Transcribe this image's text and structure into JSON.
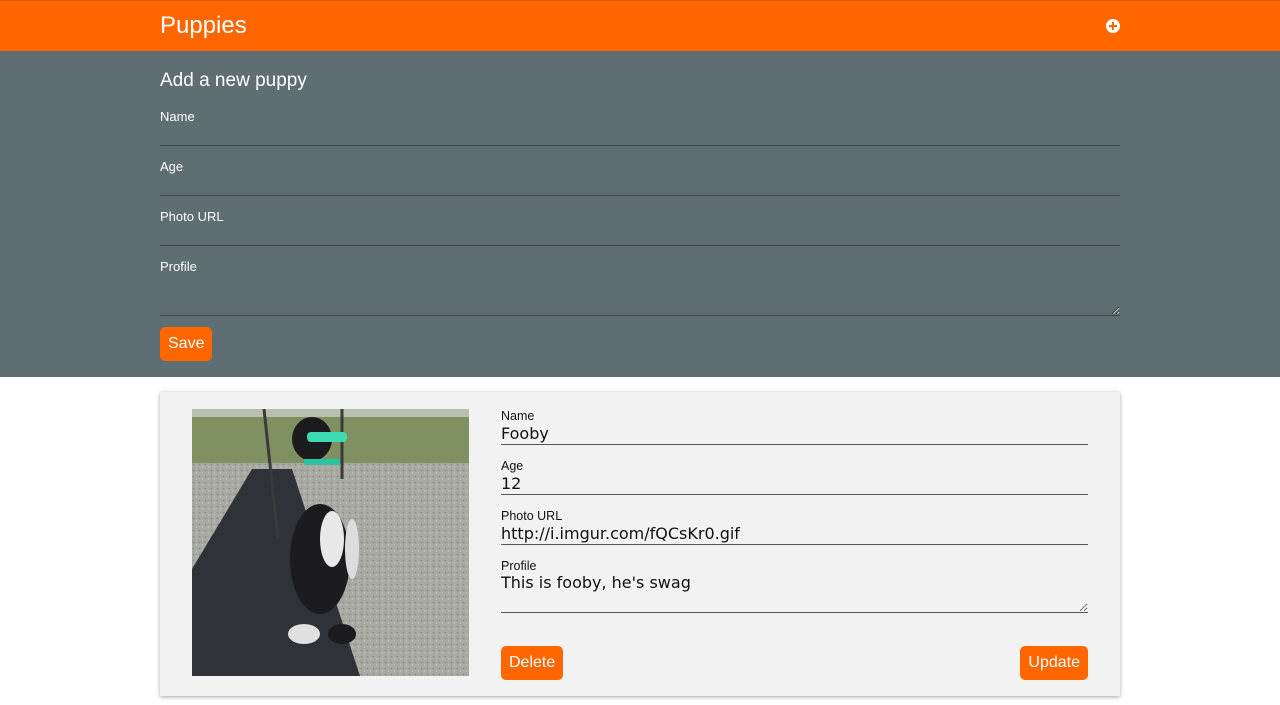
{
  "header": {
    "title": "Puppies",
    "add_icon": "plus-circle-icon"
  },
  "new_puppy_form": {
    "heading": "Add a new puppy",
    "fields": {
      "name": {
        "label": "Name",
        "value": ""
      },
      "age": {
        "label": "Age",
        "value": ""
      },
      "photo_url": {
        "label": "Photo URL",
        "value": ""
      },
      "profile": {
        "label": "Profile",
        "value": ""
      }
    },
    "save_label": "Save"
  },
  "puppy_card": {
    "photo_alt": "Dog with sunglasses on a swing",
    "fields": {
      "name": {
        "label": "Name",
        "value": "Fooby"
      },
      "age": {
        "label": "Age",
        "value": "12"
      },
      "photo_url": {
        "label": "Photo URL",
        "value": "http://i.imgur.com/fQCsKr0.gif"
      },
      "profile": {
        "label": "Profile",
        "value": "This is fooby, he's swag"
      }
    },
    "delete_label": "Delete",
    "update_label": "Update"
  },
  "colors": {
    "accent": "#ff6600",
    "panel": "#5f6e73",
    "card": "#f2f2f2"
  }
}
